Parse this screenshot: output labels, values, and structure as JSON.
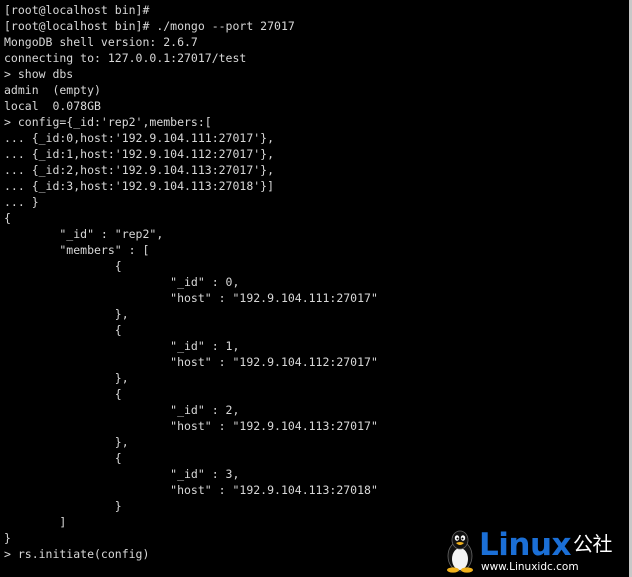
{
  "terminal": {
    "lines": [
      "[root@localhost bin]#",
      "[root@localhost bin]# ./mongo --port 27017",
      "MongoDB shell version: 2.6.7",
      "connecting to: 127.0.0.1:27017/test",
      "> show dbs",
      "admin  (empty)",
      "local  0.078GB",
      "> config={_id:'rep2',members:[",
      "... {_id:0,host:'192.9.104.111:27017'},",
      "... {_id:1,host:'192.9.104.112:27017'},",
      "... {_id:2,host:'192.9.104.113:27017'},",
      "... {_id:3,host:'192.9.104.113:27018'}]",
      "... }",
      "{",
      "        \"_id\" : \"rep2\",",
      "        \"members\" : [",
      "                {",
      "                        \"_id\" : 0,",
      "                        \"host\" : \"192.9.104.111:27017\"",
      "                },",
      "                {",
      "                        \"_id\" : 1,",
      "                        \"host\" : \"192.9.104.112:27017\"",
      "                },",
      "                {",
      "                        \"_id\" : 2,",
      "                        \"host\" : \"192.9.104.113:27017\"",
      "                },",
      "                {",
      "                        \"_id\" : 3,",
      "                        \"host\" : \"192.9.104.113:27018\"",
      "                }",
      "        ]",
      "}",
      "> rs.initiate(config)"
    ]
  },
  "watermark": {
    "brand": "Linux",
    "brand_suffix": "公社",
    "url": "www.Linuxidc.com",
    "icon": "tux-penguin-icon"
  },
  "colors": {
    "background": "#000000",
    "text": "#d8d8d8",
    "brand": "#1b6fd6"
  }
}
